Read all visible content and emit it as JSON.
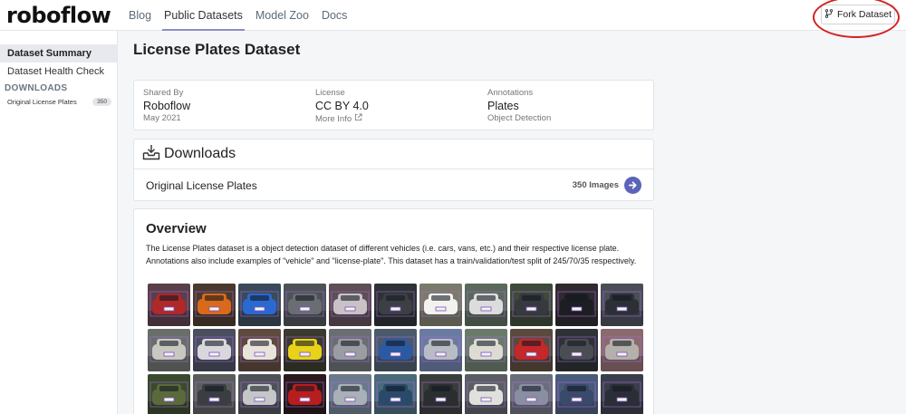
{
  "brand": {
    "logo": "roboflow"
  },
  "nav": {
    "links": [
      {
        "label": "Blog",
        "active": false
      },
      {
        "label": "Public Datasets",
        "active": true
      },
      {
        "label": "Model Zoo",
        "active": false
      },
      {
        "label": "Docs",
        "active": false
      }
    ],
    "fork_label": "Fork Dataset"
  },
  "sidebar": {
    "items": [
      {
        "label": "Dataset Summary",
        "active": true
      },
      {
        "label": "Dataset Health Check",
        "active": false
      }
    ],
    "downloads_heading": "DOWNLOADS",
    "downloads": [
      {
        "label": "Original License Plates",
        "count": "350"
      }
    ]
  },
  "page": {
    "title": "License Plates Dataset"
  },
  "info": {
    "shared_by": {
      "label": "Shared By",
      "value": "Roboflow",
      "sub": "May 2021"
    },
    "license": {
      "label": "License",
      "value": "CC BY 4.0",
      "sub": "More Info"
    },
    "annotations": {
      "label": "Annotations",
      "value": "Plates",
      "sub": "Object Detection"
    }
  },
  "downloads": {
    "title": "Downloads",
    "rows": [
      {
        "name": "Original License Plates",
        "count": "350 Images"
      }
    ]
  },
  "overview": {
    "title": "Overview",
    "text": "The License Plates dataset is a object detection dataset of different vehicles (i.e. cars, vans, etc.) and their respective license plate. Annotations also include examples of \"vehicle\" and \"license-plate\". This dataset has a train/validation/test split of 245/70/35 respectively."
  },
  "thumbnails": [
    {
      "bg": "#5a3f4a",
      "car": "#b02828"
    },
    {
      "bg": "#4a3a2e",
      "car": "#d86a1a"
    },
    {
      "bg": "#3a4a5a",
      "car": "#2a6ad0"
    },
    {
      "bg": "#4d5256",
      "car": "#6a6e72"
    },
    {
      "bg": "#5e4e56",
      "car": "#c8c2c6"
    },
    {
      "bg": "#2e3236",
      "car": "#3c4044"
    },
    {
      "bg": "#7a7a6a",
      "car": "#f2f2ee"
    },
    {
      "bg": "#5a6a5a",
      "car": "#dcdcdc"
    },
    {
      "bg": "#3e4a3a",
      "car": "#363a3e"
    },
    {
      "bg": "#2e2a2e",
      "car": "#1c1e22"
    },
    {
      "bg": "#4a4e56",
      "car": "#2c3036"
    },
    {
      "bg": "#6a6e6a",
      "car": "#c8c8c0"
    },
    {
      "bg": "#4a4e5e",
      "car": "#d8d8dc"
    },
    {
      "bg": "#5e4a3e",
      "car": "#e8e4dc"
    },
    {
      "bg": "#3a3a2e",
      "car": "#e8d21a"
    },
    {
      "bg": "#6a6e72",
      "car": "#9a9ea2"
    },
    {
      "bg": "#4a5a6a",
      "car": "#2a5aa2"
    },
    {
      "bg": "#6a7aa0",
      "car": "#b8bcc4"
    },
    {
      "bg": "#6a7a6a",
      "car": "#dcdcd4"
    },
    {
      "bg": "#5a4a3e",
      "car": "#c42828"
    },
    {
      "bg": "#2e3236",
      "car": "#4a4e52"
    },
    {
      "bg": "#8a6a6e",
      "car": "#b4b0aa"
    },
    {
      "bg": "#3a4a2e",
      "car": "#5a6a3a"
    },
    {
      "bg": "#5a5e5a",
      "car": "#3a3e42"
    },
    {
      "bg": "#4e5256",
      "car": "#c4c6c8"
    },
    {
      "bg": "#2a1a1e",
      "car": "#b81e1e"
    },
    {
      "bg": "#6a7a8a",
      "car": "#a8b0b8"
    },
    {
      "bg": "#4a6a7a",
      "car": "#2a4a6a"
    },
    {
      "bg": "#3a3e3a",
      "car": "#2a2e2e"
    },
    {
      "bg": "#5a5e62",
      "car": "#e0e0dc"
    },
    {
      "bg": "#6a6e7a",
      "car": "#8a8ea2"
    },
    {
      "bg": "#4a5a7a",
      "car": "#3a4a6a"
    },
    {
      "bg": "#3a3e4a",
      "car": "#2a2e36"
    }
  ]
}
